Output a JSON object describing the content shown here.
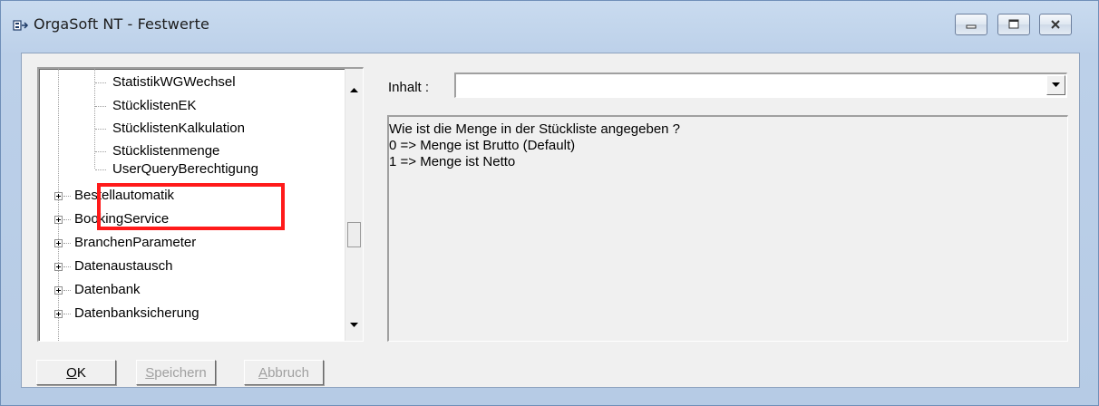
{
  "window": {
    "title": "OrgaSoft NT - Festwerte",
    "controls": [
      "minimize-icon",
      "maximize-icon",
      "close-icon"
    ]
  },
  "tree": {
    "items": [
      {
        "label": "StatistikWGWechsel",
        "level": 2,
        "expandable": false
      },
      {
        "label": "StücklistenEK",
        "level": 2,
        "expandable": false
      },
      {
        "label": "StücklistenKalkulation",
        "level": 2,
        "expandable": false
      },
      {
        "label": "Stücklistenmenge",
        "level": 2,
        "expandable": false,
        "selected": true
      },
      {
        "label": "UserQueryBerechtigung",
        "level": 2,
        "expandable": false
      },
      {
        "label": "Bestellautomatik",
        "level": 1,
        "expandable": true
      },
      {
        "label": "BookingService",
        "level": 1,
        "expandable": true
      },
      {
        "label": "BranchenParameter",
        "level": 1,
        "expandable": true
      },
      {
        "label": "Datenaustausch",
        "level": 1,
        "expandable": true
      },
      {
        "label": "Datenbank",
        "level": 1,
        "expandable": true
      },
      {
        "label": "Datenbanksicherung",
        "level": 1,
        "expandable": true
      }
    ],
    "scroll_position": 0.55
  },
  "content": {
    "inhalt_label": "Inhalt :",
    "inhalt_value": "",
    "description_lines": [
      "Wie ist die Menge in der Stückliste angegeben ?",
      "0 => Menge ist Brutto (Default)",
      "1 => Menge ist Netto"
    ]
  },
  "buttons": {
    "ok_mnemonic": "O",
    "ok_rest": "K",
    "save_mnemonic": "S",
    "save_rest": "peichern",
    "cancel_mnemonic": "A",
    "cancel_rest": "bbruch"
  },
  "colors": {
    "highlight": "#ff1a1a",
    "window_frame": "#bcd0e9"
  }
}
